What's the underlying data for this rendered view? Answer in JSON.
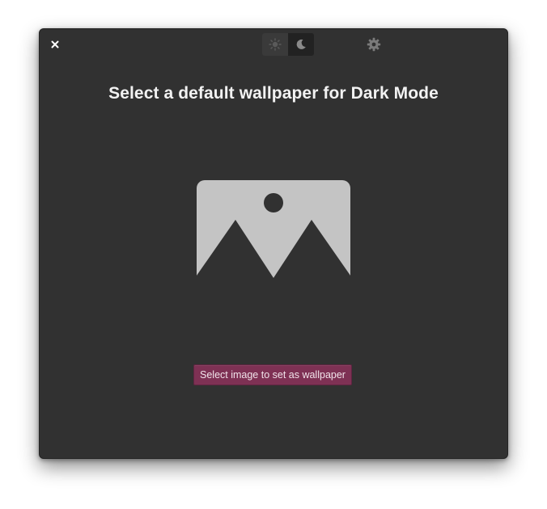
{
  "window": {
    "title": "Select a default wallpaper for Dark Mode"
  },
  "header": {
    "close_icon": "close-icon",
    "mode_switch": {
      "light_icon": "sun-icon",
      "dark_icon": "moon-icon",
      "selected": "dark"
    },
    "settings_icon": "gear-icon"
  },
  "main": {
    "placeholder_icon": "image-placeholder-icon",
    "select_button_label": "Select image to set as wallpaper"
  },
  "colors": {
    "window_bg": "#313131",
    "accent": "#7e3154",
    "title_text": "#f2f2f2",
    "placeholder": "#c4c4c4"
  }
}
